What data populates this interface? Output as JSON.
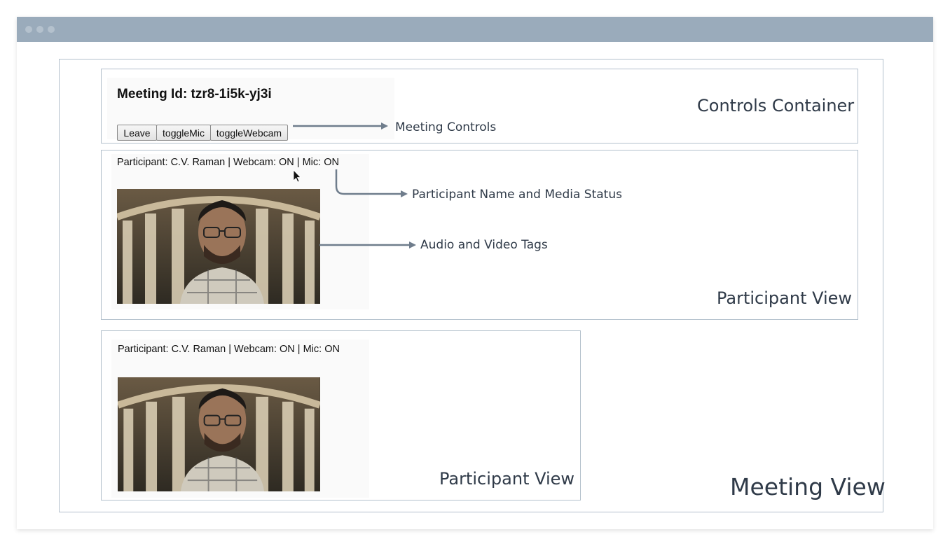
{
  "window": {
    "controls": [
      "close-dot",
      "minimize-dot",
      "maximize-dot"
    ]
  },
  "meeting_view": {
    "label": "Meeting View"
  },
  "controls_container": {
    "label": "Controls Container",
    "meeting_id_text": "Meeting Id: tzr8-1i5k-yj3i",
    "buttons": {
      "leave": "Leave",
      "toggle_mic": "toggleMic",
      "toggle_webcam": "toggleWebcam"
    }
  },
  "participants": [
    {
      "status": "Participant: C.V. Raman | Webcam: ON | Mic: ON",
      "label": "Participant View"
    },
    {
      "status": "Participant: C.V. Raman | Webcam: ON | Mic: ON",
      "label": "Participant View"
    }
  ],
  "annotations": {
    "meeting_controls": "Meeting Controls",
    "name_status": "Participant Name and Media Status",
    "av_tags": "Audio and Video Tags"
  },
  "colors": {
    "titlebar": "#9aabbb",
    "border": "#b3c0cc",
    "arrow": "#6f7d8c",
    "label_text": "#2f3a48"
  }
}
